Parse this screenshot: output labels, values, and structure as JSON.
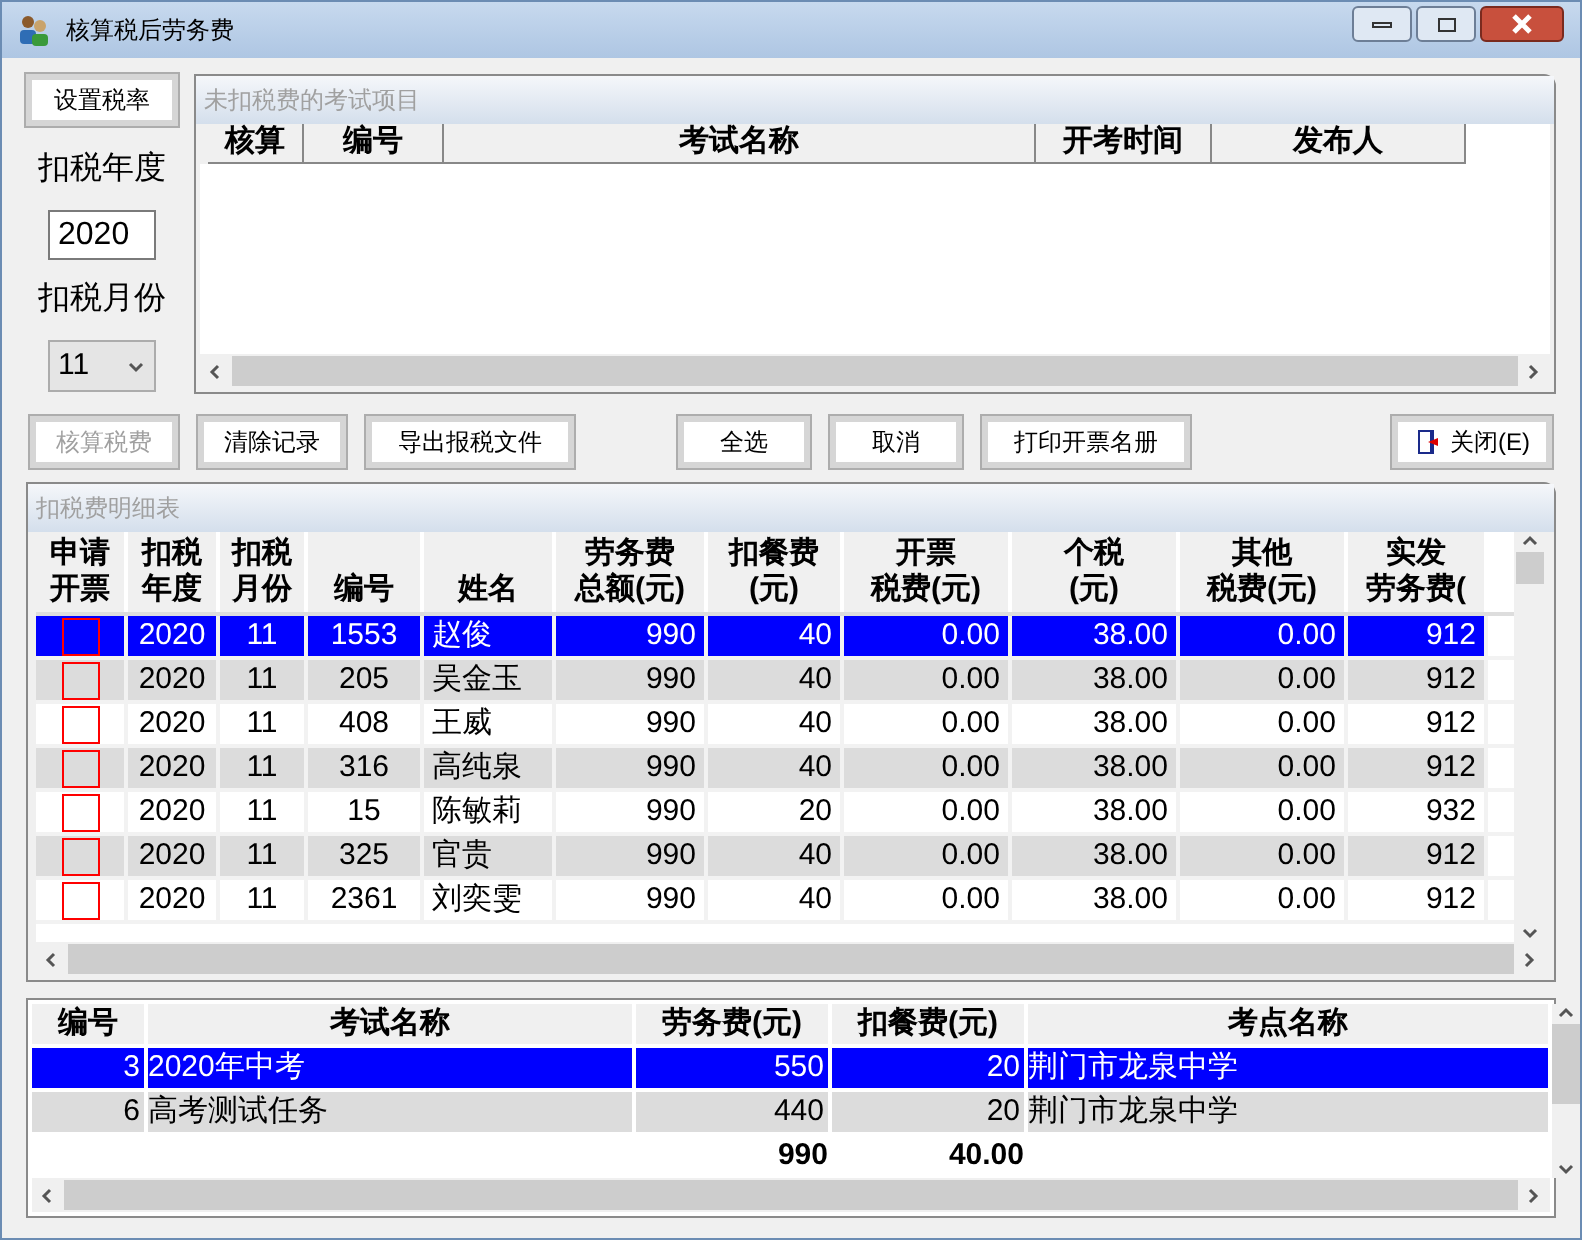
{
  "window": {
    "title": "核算税后劳务费"
  },
  "settings": {
    "set_rate_button": "设置税率",
    "year_label": "扣税年度",
    "year_value": "2020",
    "month_label": "扣税月份",
    "month_value": "11"
  },
  "pending_exams": {
    "title": "未扣税费的考试项目",
    "columns": [
      "核算",
      "编号",
      "考试名称",
      "开考时间",
      "发布人"
    ]
  },
  "buttons": [
    {
      "label": "核算税费",
      "disabled": true,
      "kind": "plain"
    },
    {
      "label": "清除记录",
      "disabled": false,
      "kind": "plain"
    },
    {
      "label": "导出报税文件",
      "disabled": false,
      "kind": "plain"
    },
    {
      "label": "全选",
      "disabled": false,
      "kind": "plain"
    },
    {
      "label": "取消",
      "disabled": false,
      "kind": "plain"
    },
    {
      "label": "打印开票名册",
      "disabled": false,
      "kind": "plain"
    },
    {
      "label": "关闭(E)",
      "disabled": false,
      "kind": "close"
    }
  ],
  "details": {
    "title": "扣税费明细表",
    "columns": [
      {
        "lines": [
          "申请",
          "开票"
        ]
      },
      {
        "lines": [
          "扣税",
          "年度"
        ]
      },
      {
        "lines": [
          "扣税",
          "月份"
        ]
      },
      {
        "lines": [
          "编号"
        ]
      },
      {
        "lines": [
          "姓名"
        ]
      },
      {
        "lines": [
          "劳务费",
          "总额(元)"
        ]
      },
      {
        "lines": [
          "扣餐费",
          "(元)"
        ]
      },
      {
        "lines": [
          "开票",
          "税费(元)"
        ]
      },
      {
        "lines": [
          "个税",
          "(元)"
        ]
      },
      {
        "lines": [
          "其他",
          "税费(元)"
        ]
      },
      {
        "lines": [
          "实发",
          "劳务费("
        ]
      }
    ],
    "rows": [
      {
        "selected": true,
        "checked": false,
        "cells": [
          "",
          "2020",
          "11",
          "1553",
          "赵俊",
          "990",
          "40",
          "0.00",
          "38.00",
          "0.00",
          "912"
        ]
      },
      {
        "selected": false,
        "checked": false,
        "cells": [
          "",
          "2020",
          "11",
          "205",
          "吴金玉",
          "990",
          "40",
          "0.00",
          "38.00",
          "0.00",
          "912"
        ]
      },
      {
        "selected": false,
        "checked": false,
        "cells": [
          "",
          "2020",
          "11",
          "408",
          "王威",
          "990",
          "40",
          "0.00",
          "38.00",
          "0.00",
          "912"
        ]
      },
      {
        "selected": false,
        "checked": false,
        "cells": [
          "",
          "2020",
          "11",
          "316",
          "高纯泉",
          "990",
          "40",
          "0.00",
          "38.00",
          "0.00",
          "912"
        ]
      },
      {
        "selected": false,
        "checked": false,
        "cells": [
          "",
          "2020",
          "11",
          "15",
          "陈敏莉",
          "990",
          "20",
          "0.00",
          "38.00",
          "0.00",
          "932"
        ]
      },
      {
        "selected": false,
        "checked": false,
        "cells": [
          "",
          "2020",
          "11",
          "325",
          "官贵",
          "990",
          "40",
          "0.00",
          "38.00",
          "0.00",
          "912"
        ]
      },
      {
        "selected": false,
        "checked": false,
        "cells": [
          "",
          "2020",
          "11",
          "2361",
          "刘奕雯",
          "990",
          "40",
          "0.00",
          "38.00",
          "0.00",
          "912"
        ]
      }
    ]
  },
  "summary": {
    "columns": [
      "编号",
      "考试名称",
      "劳务费(元)",
      "扣餐费(元)",
      "考点名称"
    ],
    "rows": [
      {
        "selected": true,
        "cells": [
          "3",
          "2020年中考",
          "550",
          "20",
          "荆门市龙泉中学"
        ]
      },
      {
        "selected": false,
        "cells": [
          "6",
          "高考测试任务",
          "440",
          "20",
          "荆门市龙泉中学"
        ]
      }
    ],
    "totals": [
      "990",
      "40.00"
    ]
  }
}
